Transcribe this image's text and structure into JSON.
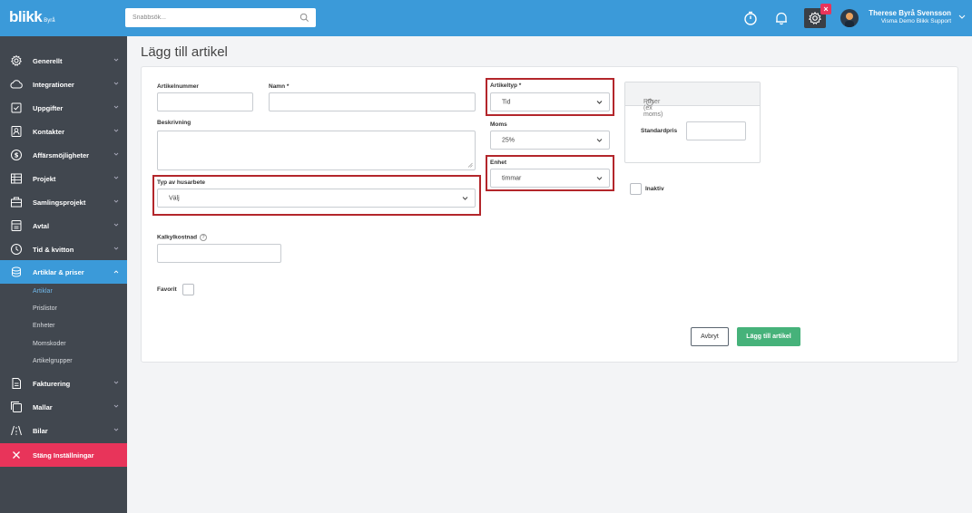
{
  "topbar": {
    "logo_text": "blikk",
    "logo_sub": "Byrå",
    "search_placeholder": "Snabbsök...",
    "notification_badge": "×",
    "user_name": "Therese Byrå Svensson",
    "user_company": "Visma Demo Blikk Support",
    "icons": [
      "timer-icon",
      "bell-icon",
      "gear-icon",
      "search-icon"
    ]
  },
  "sidebar": {
    "items": [
      {
        "label": "Generellt",
        "icon": "gear-icon"
      },
      {
        "label": "Integrationer",
        "icon": "cloud-icon"
      },
      {
        "label": "Uppgifter",
        "icon": "checkbox-icon"
      },
      {
        "label": "Kontakter",
        "icon": "contact-icon"
      },
      {
        "label": "Affärsmöjligheter",
        "icon": "dollar-icon"
      },
      {
        "label": "Projekt",
        "icon": "grid-icon"
      },
      {
        "label": "Samlingsprojekt",
        "icon": "folder-icon"
      },
      {
        "label": "Avtal",
        "icon": "contract-icon"
      },
      {
        "label": "Tid & kvitton",
        "icon": "clock-icon"
      },
      {
        "label": "Artiklar & priser",
        "icon": "database-icon"
      }
    ],
    "sub_items": [
      "Artiklar",
      "Prislistor",
      "Enheter",
      "Momskoder",
      "Artikelgrupper"
    ],
    "items_after": [
      {
        "label": "Fakturering",
        "icon": "invoice-icon"
      },
      {
        "label": "Mallar",
        "icon": "template-icon"
      },
      {
        "label": "Bilar",
        "icon": "road-icon"
      }
    ],
    "close_label": "Stäng Inställningar"
  },
  "main": {
    "title": "Lägg till artikel",
    "form": {
      "artikelnummer_label": "Artikelnummer",
      "namn_label": "Namn *",
      "beskrivning_label": "Beskrivning",
      "typ_husarbete_label": "Typ av husarbete",
      "typ_husarbete_value": "Välj",
      "kalkylkostnad_label": "Kalkylkostnad",
      "favorit_label": "Favorit",
      "artikeltyp_label": "Artikeltyp *",
      "artikeltyp_value": "Tid",
      "moms_label": "Moms",
      "moms_value": "25%",
      "enhet_label": "Enhet",
      "enhet_value": "timmar",
      "inaktiv_label": "Inaktiv",
      "priser_header": "Priser (ex moms)",
      "standardpris_label": "Standardpris",
      "help_glyph": "?"
    },
    "buttons": {
      "cancel": "Avbryt",
      "add": "Lägg till artikel"
    }
  },
  "colors": {
    "topbar": "#3b9ad9",
    "sidebar": "#41474f",
    "active": "#3b9ad9",
    "close": "#e8345a",
    "primary_button": "#46b27a",
    "highlight_box": "#b3262b"
  }
}
